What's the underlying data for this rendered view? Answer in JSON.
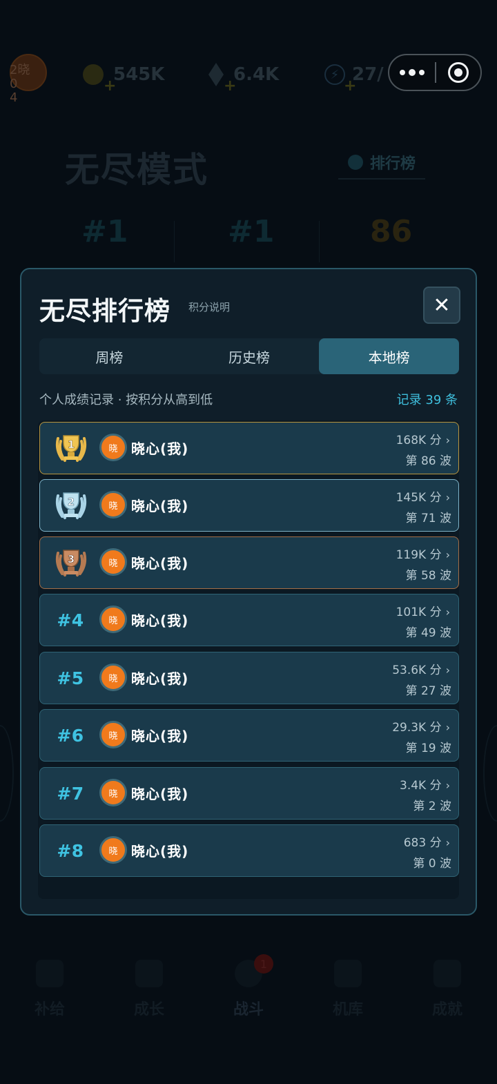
{
  "header": {
    "avatar_text": "2晓\n0\n4",
    "coins": "545K",
    "gems": "6.4K",
    "energy": "27/"
  },
  "background": {
    "title": "无尽模式",
    "leaderboard_tab": "排行榜",
    "stats": [
      "#1",
      "#1",
      "86"
    ]
  },
  "bottom_nav": {
    "items": [
      "补给",
      "成长",
      "战斗",
      "机库",
      "成就"
    ],
    "battle_badge": "1"
  },
  "modal": {
    "title": "无尽排行榜",
    "score_rules_link": "积分说明",
    "close_label": "✕",
    "tabs": [
      "周榜",
      "历史榜",
      "本地榜"
    ],
    "active_tab": "本地榜",
    "subhead": "个人成绩记录 · 按积分从高到低",
    "record_count": "记录 39 条"
  },
  "ranks": [
    {
      "rank": "1",
      "avatar_char": "晓",
      "name": "晓心(我)",
      "score": "168K 分",
      "wave": "第 86 波",
      "medal": "gold"
    },
    {
      "rank": "2",
      "avatar_char": "晓",
      "name": "晓心(我)",
      "score": "145K 分",
      "wave": "第 71 波",
      "medal": "silver"
    },
    {
      "rank": "3",
      "avatar_char": "晓",
      "name": "晓心(我)",
      "score": "119K 分",
      "wave": "第 58 波",
      "medal": "bronze"
    },
    {
      "rank": "#4",
      "avatar_char": "晓",
      "name": "晓心(我)",
      "score": "101K 分",
      "wave": "第 49 波"
    },
    {
      "rank": "#5",
      "avatar_char": "晓",
      "name": "晓心(我)",
      "score": "53.6K 分",
      "wave": "第 27 波"
    },
    {
      "rank": "#6",
      "avatar_char": "晓",
      "name": "晓心(我)",
      "score": "29.3K 分",
      "wave": "第 19 波"
    },
    {
      "rank": "#7",
      "avatar_char": "晓",
      "name": "晓心(我)",
      "score": "3.4K 分",
      "wave": "第 2 波"
    },
    {
      "rank": "#8",
      "avatar_char": "晓",
      "name": "晓心(我)",
      "score": "683 分",
      "wave": "第 0 波"
    }
  ],
  "colors": {
    "accent_cyan": "#3fc3e2",
    "gold": "#e7b84a",
    "silver": "#a9d3e6",
    "bronze": "#b57a52",
    "avatar_orange": "#f07a1c"
  }
}
